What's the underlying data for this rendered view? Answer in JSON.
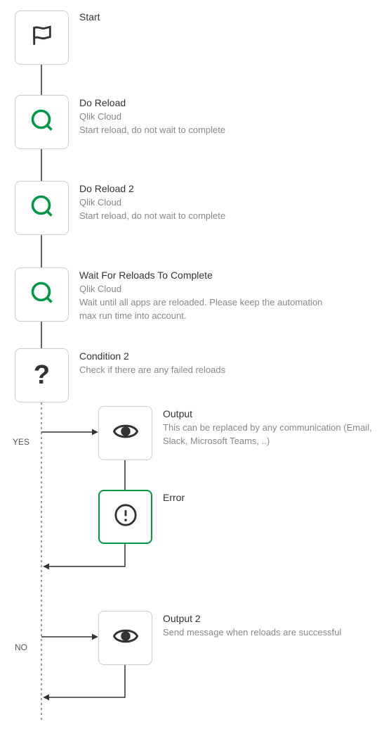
{
  "chart_data": {
    "type": "diagram",
    "nodes": [
      {
        "id": "start",
        "title": "Start",
        "subtitle": null,
        "description": null,
        "icon": "flag"
      },
      {
        "id": "reload1",
        "title": "Do Reload",
        "subtitle": "Qlik Cloud",
        "description": "Start reload, do not wait to complete",
        "icon": "qlik"
      },
      {
        "id": "reload2",
        "title": "Do Reload 2",
        "subtitle": "Qlik Cloud",
        "description": "Start reload, do not wait to complete",
        "icon": "qlik"
      },
      {
        "id": "wait",
        "title": "Wait For Reloads To Complete",
        "subtitle": "Qlik Cloud",
        "description": "Wait until all apps are reloaded. Please keep the automation max run time into account.",
        "icon": "qlik"
      },
      {
        "id": "cond",
        "title": "Condition 2",
        "subtitle": null,
        "description": "Check if there are any failed reloads",
        "icon": "question"
      },
      {
        "id": "output",
        "title": "Output",
        "subtitle": null,
        "description": "This can be replaced by any communication (Email, Slack, Microsoft Teams, ..)",
        "icon": "eye"
      },
      {
        "id": "error",
        "title": "Error",
        "subtitle": null,
        "description": null,
        "icon": "alert"
      },
      {
        "id": "output2",
        "title": "Output 2",
        "subtitle": null,
        "description": "Send message when reloads are successful",
        "icon": "eye"
      }
    ],
    "edges": [
      {
        "from": "start",
        "to": "reload1"
      },
      {
        "from": "reload1",
        "to": "reload2"
      },
      {
        "from": "reload2",
        "to": "wait"
      },
      {
        "from": "wait",
        "to": "cond"
      },
      {
        "from": "cond",
        "to": "output",
        "label": "YES"
      },
      {
        "from": "output",
        "to": "error"
      },
      {
        "from": "cond",
        "to": "output2",
        "label": "NO"
      }
    ]
  },
  "labels": {
    "yes": "YES",
    "no": "NO"
  }
}
